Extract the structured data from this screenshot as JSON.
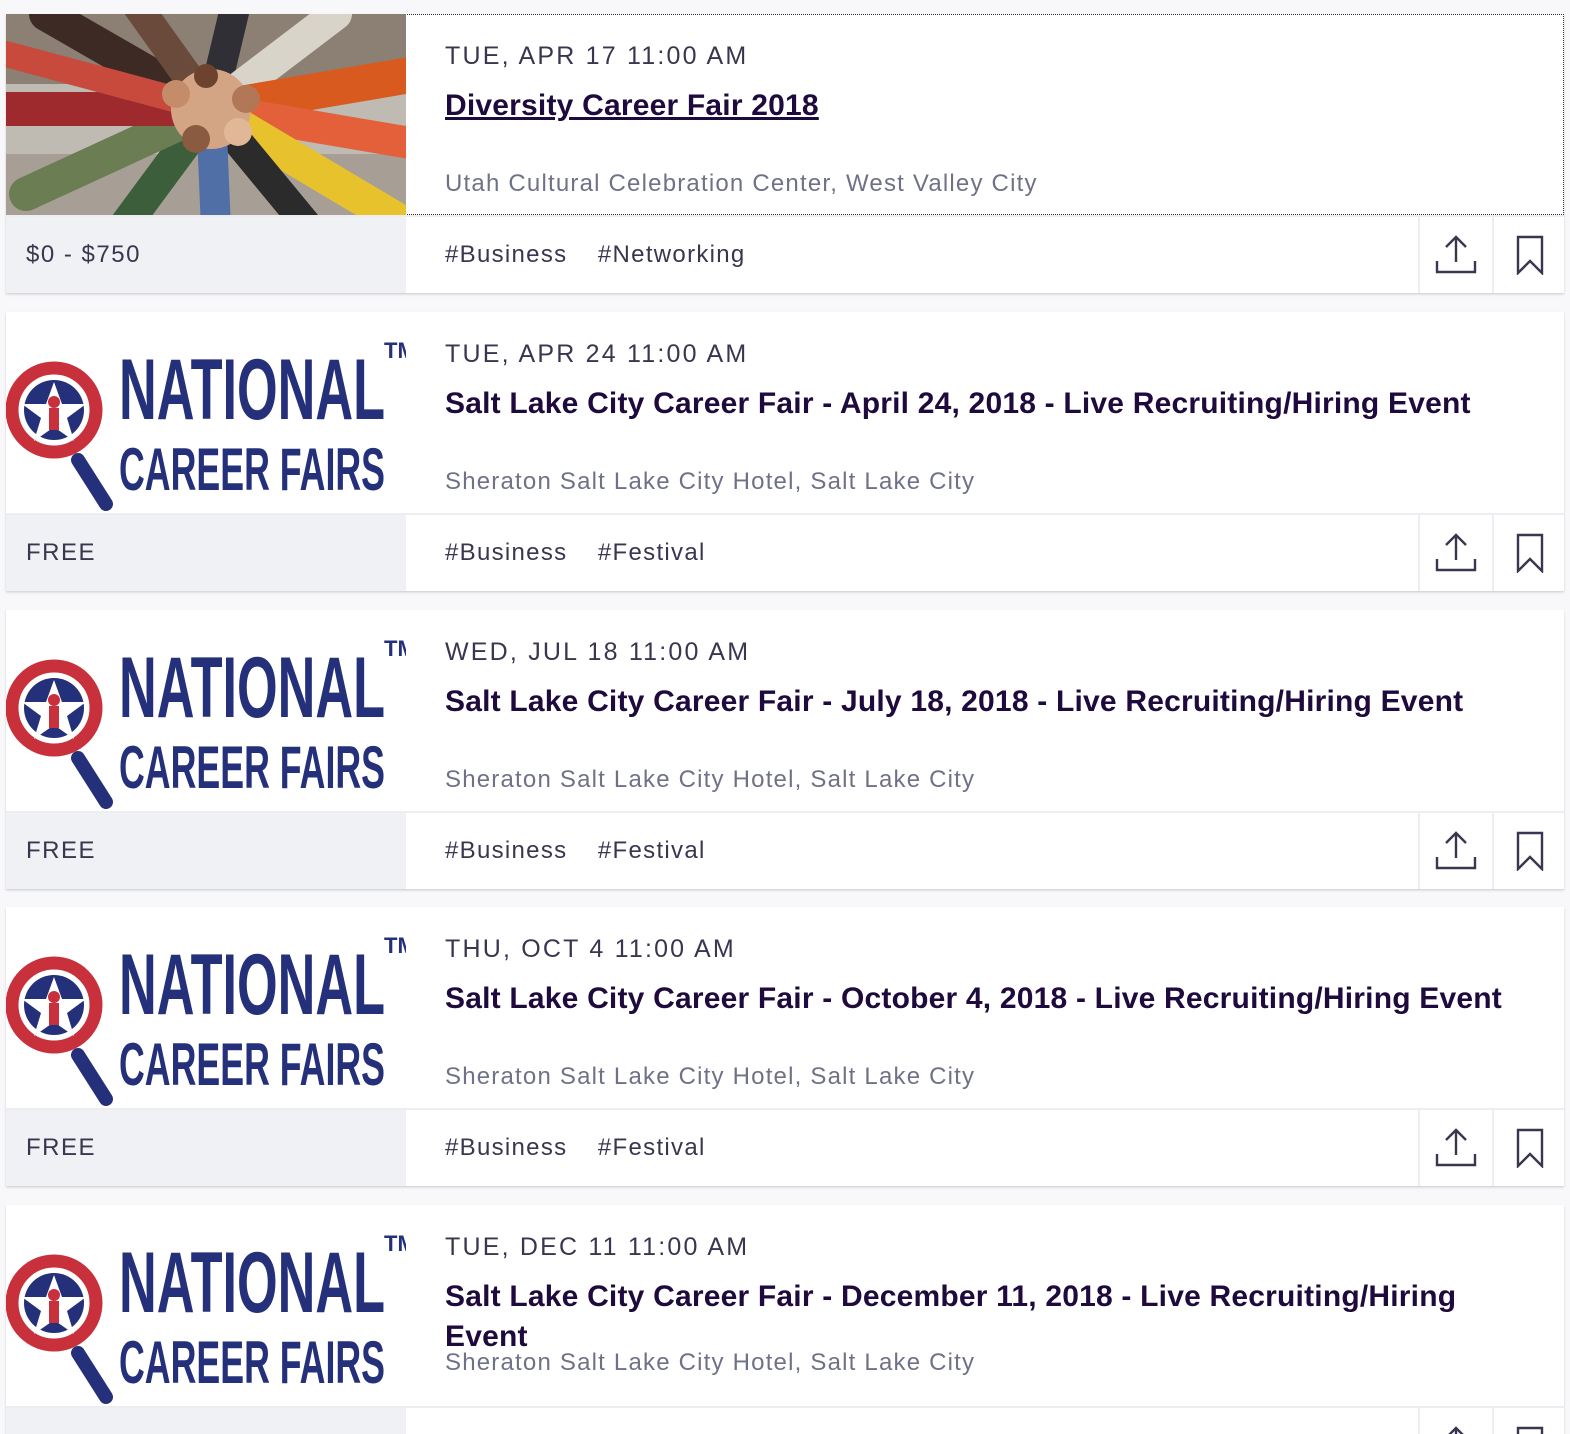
{
  "events": [
    {
      "date": "TUE, APR 17 11:00 AM",
      "title": "Diversity Career Fair 2018",
      "venue": "Utah Cultural Celebration Center, West Valley City",
      "price": "$0 - $750",
      "tags": [
        "#Business",
        "#Networking"
      ],
      "image": "hands-in-circle-photo"
    },
    {
      "date": "TUE, APR 24 11:00 AM",
      "title": "Salt Lake City Career Fair - April 24, 2018 - Live Recruiting/Hiring Event",
      "venue": "Sheraton Salt Lake City Hotel, Salt Lake City",
      "price": "FREE",
      "tags": [
        "#Business",
        "#Festival"
      ],
      "image": "national-career-fairs-logo"
    },
    {
      "date": "WED, JUL 18 11:00 AM",
      "title": "Salt Lake City Career Fair - July 18, 2018 - Live Recruiting/Hiring Event",
      "venue": "Sheraton Salt Lake City Hotel, Salt Lake City",
      "price": "FREE",
      "tags": [
        "#Business",
        "#Festival"
      ],
      "image": "national-career-fairs-logo"
    },
    {
      "date": "THU, OCT 4 11:00 AM",
      "title": "Salt Lake City Career Fair - October 4, 2018 - Live Recruiting/Hiring Event",
      "venue": "Sheraton Salt Lake City Hotel, Salt Lake City",
      "price": "FREE",
      "tags": [
        "#Business",
        "#Festival"
      ],
      "image": "national-career-fairs-logo"
    },
    {
      "date": "TUE, DEC 11 11:00 AM",
      "title": "Salt Lake City Career Fair - December 11, 2018 - Live Recruiting/Hiring Event",
      "venue": "Sheraton Salt Lake City Hotel, Salt Lake City",
      "price": "",
      "tags": [],
      "image": "national-career-fairs-logo"
    }
  ],
  "logo": {
    "line1": "NATIONAL",
    "line2": "CAREER FAIRS",
    "mark": "TM"
  },
  "colors": {
    "logo_navy": "#25307a",
    "logo_red": "#c8313b",
    "title": "#1e0a3c",
    "muted": "#6f7287",
    "price_bg": "#eff1f4"
  }
}
